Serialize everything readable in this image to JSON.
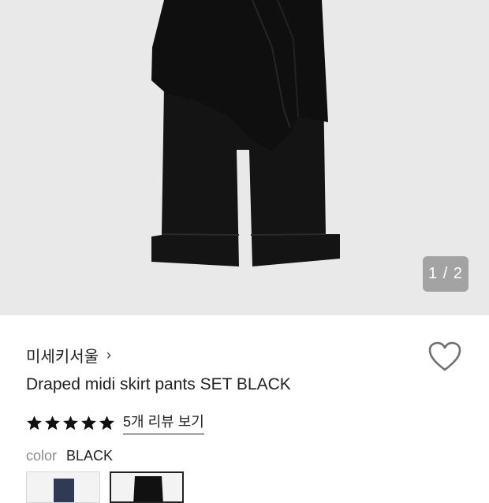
{
  "gallery": {
    "counter": "1 / 2"
  },
  "product": {
    "brand": "미세키서울",
    "brand_chevron": "›",
    "title": "Draped midi skirt pants SET BLACK",
    "rating": {
      "stars": 5,
      "reviews_label": "5개 리뷰 보기"
    },
    "color": {
      "label": "color",
      "value": "BLACK"
    },
    "swatches": [
      {
        "name": "navy",
        "color": "#2f3a56",
        "selected": false
      },
      {
        "name": "black",
        "color": "#111111",
        "selected": true
      }
    ]
  }
}
